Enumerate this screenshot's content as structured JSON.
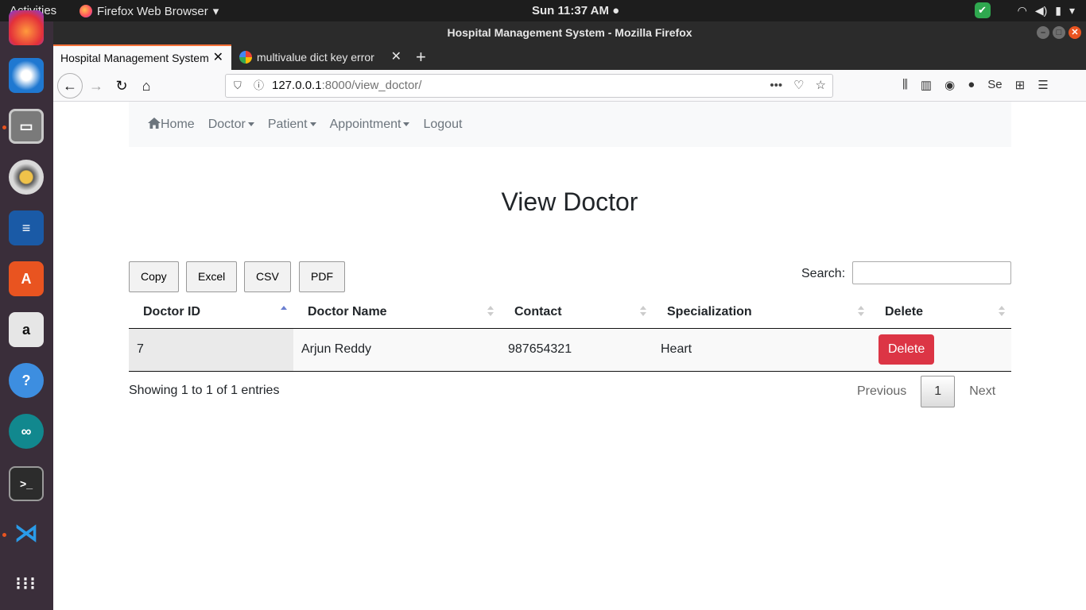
{
  "topbar": {
    "activities": "Activities",
    "app_menu": "Firefox Web Browser",
    "clock": "Sun 11:37 AM"
  },
  "window": {
    "title": "Hospital Management System - Mozilla Firefox"
  },
  "tabs": [
    {
      "label": "Hospital Management System",
      "active": true
    },
    {
      "label": "multivalue dict key error",
      "active": false
    }
  ],
  "urlbar": {
    "host": "127.0.0.1",
    "path": ":8000/view_doctor/"
  },
  "nav": {
    "home": "Home",
    "doctor": "Doctor",
    "patient": "Patient",
    "appointment": "Appointment",
    "logout": "Logout"
  },
  "page": {
    "title": "View Doctor"
  },
  "export_buttons": [
    "Copy",
    "Excel",
    "CSV",
    "PDF"
  ],
  "search": {
    "label": "Search:",
    "value": ""
  },
  "table": {
    "columns": [
      "Doctor ID",
      "Doctor Name",
      "Contact",
      "Specialization",
      "Delete"
    ],
    "rows": [
      {
        "id": "7",
        "name": "Arjun Reddy",
        "contact": "987654321",
        "specialization": "Heart",
        "action": "Delete"
      }
    ]
  },
  "footer": {
    "info": "Showing 1 to 1 of 1 entries",
    "previous": "Previous",
    "page": "1",
    "next": "Next"
  },
  "colors": {
    "danger": "#dc3545",
    "navbar_bg": "#f8f9fa",
    "accent_tab": "#ff7139"
  }
}
